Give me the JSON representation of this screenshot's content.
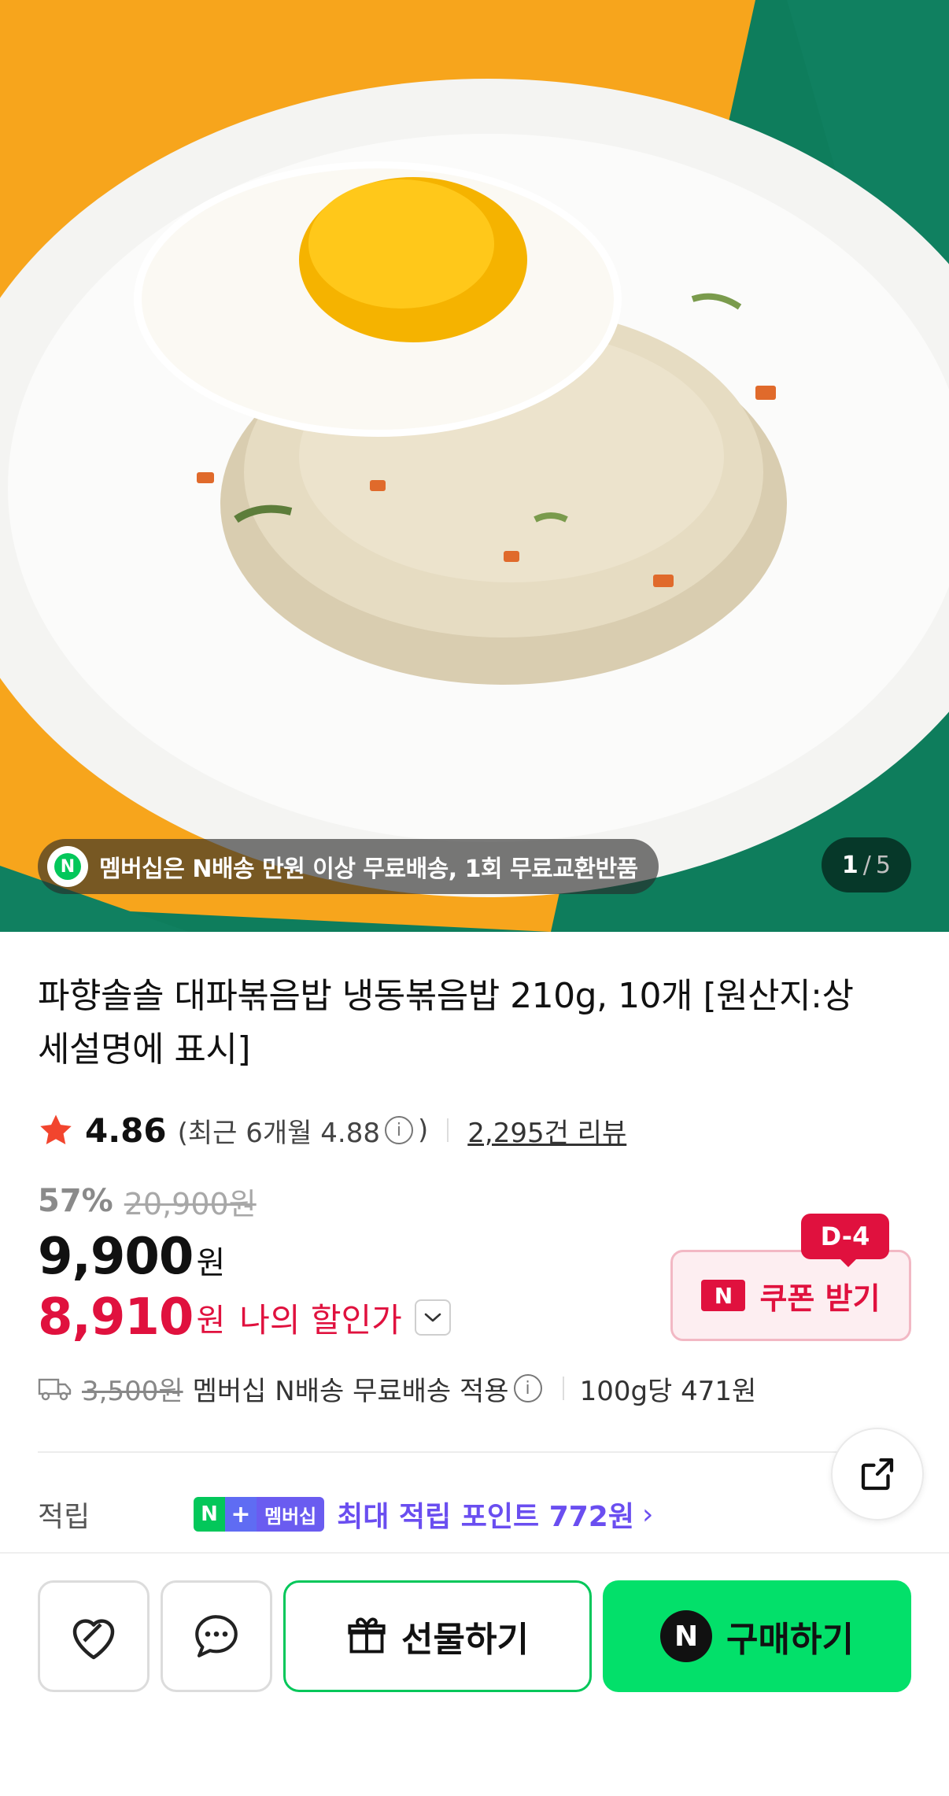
{
  "hero": {
    "promo_text": "멤버십은 N배송 만원 이상 무료배송, 1회 무료교환반품",
    "promo_icon_letter": "N",
    "page_current": "1",
    "page_separator": "/",
    "page_total": "5"
  },
  "product": {
    "title": "파향솔솔 대파볶음밥 냉동볶음밥 210g, 10개 [원산지:상세설명에 표시]",
    "rating": "4.86",
    "recent_rating": "(최근 6개월 4.88",
    "recent_close": ")",
    "info_glyph": "i",
    "review_count": "2,295건 리뷰",
    "discount_rate": "57%",
    "original_price": "20,900원",
    "price": "9,900",
    "price_unit": "원",
    "my_price": "8,910",
    "my_price_unit": "원",
    "my_price_label": "나의 할인가"
  },
  "coupon": {
    "dday": "D-4",
    "n_letter": "N",
    "label": "쿠폰 받기"
  },
  "shipping": {
    "fee": "3,500원",
    "text": "멤버십 N배송 무료배송 적용",
    "unit_price": "100g당 471원"
  },
  "points": {
    "label": "적립",
    "badge_n": "N",
    "badge_plus": "+",
    "badge_text": "멤버십",
    "text": "최대 적립 포인트 772원",
    "chevron": "›"
  },
  "bottom": {
    "gift_label": "선물하기",
    "buy_n": "N",
    "buy_label": "구매하기"
  },
  "colors": {
    "accent_red": "#e0113e",
    "naver_green": "#03c75a",
    "buy_green": "#03e06a",
    "membership_purple": "#6a4ef0"
  }
}
